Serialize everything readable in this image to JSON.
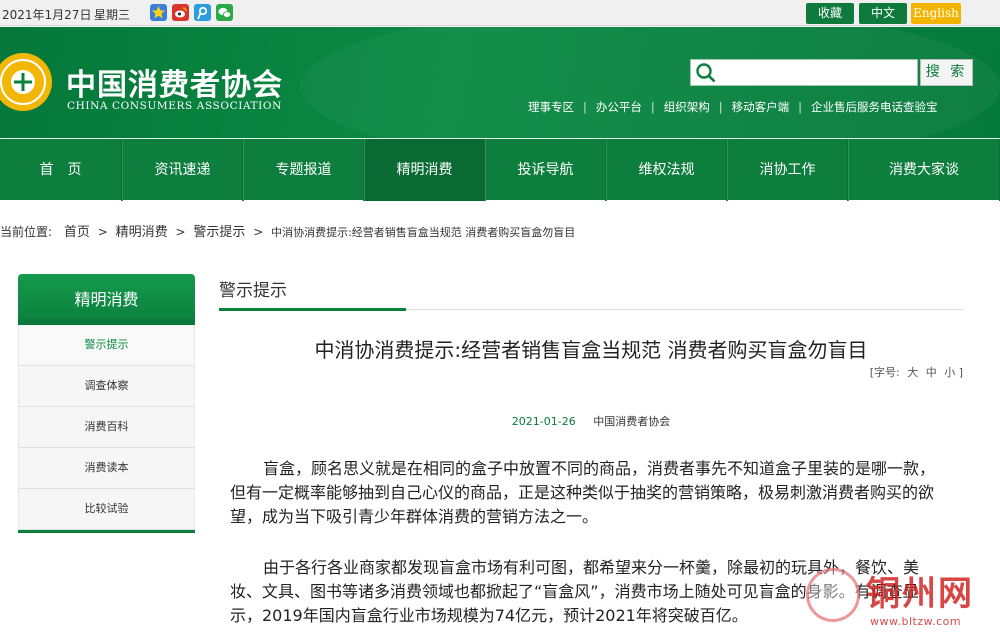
{
  "topbar": {
    "date": "2021年1月27日",
    "weekday": "星期三",
    "social_icons": [
      "qzone-icon",
      "weibo-icon",
      "tencent-weibo-icon",
      "wechat-icon"
    ],
    "lang": {
      "sc": "收藏",
      "zh": "中文",
      "en": "English"
    }
  },
  "header": {
    "org_cn": "中国消费者协会",
    "org_en": "CHINA CONSUMERS ASSOCIATION",
    "search": {
      "placeholder": "",
      "button": "搜 索"
    },
    "quicklinks": [
      "理事专区",
      "办公平台",
      "组织架构",
      "移动客户端",
      "企业售后服务电话查验宝"
    ]
  },
  "nav": {
    "items": [
      "首　页",
      "资讯速递",
      "专题报道",
      "精明消费",
      "投诉导航",
      "维权法规",
      "消协工作",
      "消费大家谈"
    ],
    "active_index": 3
  },
  "breadcrumb": {
    "prefix": "当前位置:",
    "links": [
      "首页",
      "精明消费",
      "警示提示"
    ],
    "current": "中消协消费提示:经营者销售盲盒当规范 消费者购买盲盒勿盲目"
  },
  "sidebar": {
    "title": "精明消费",
    "items": [
      "警示提示",
      "调查体察",
      "消费百科",
      "消费读本",
      "比较试验"
    ],
    "active_index": 0
  },
  "main": {
    "section_title": "警示提示",
    "article": {
      "title": "中消协消费提示:经营者销售盲盒当规范 消费者购买盲盒勿盲目",
      "fontsize_label": "[字号:",
      "fontsize_options": [
        "大",
        "中",
        "小"
      ],
      "fontsize_close": "]",
      "date": "2021-01-26",
      "source": "中国消费者协会",
      "paragraphs": [
        "盲盒，顾名思义就是在相同的盒子中放置不同的商品，消费者事先不知道盒子里装的是哪一款，但有一定概率能够抽到自己心仪的商品，正是这种类似于抽奖的营销策略，极易刺激消费者购买的欲望，成为当下吸引青少年群体消费的营销方法之一。",
        "由于各行各业商家都发现盲盒市场有利可图，都希望来分一杯羹，除最初的玩具外，餐饮、美妆、文具、图书等诸多消费领域也都掀起了“盲盒风”，消费市场上随处可见盲盒的身影。有调查显示，2019年国内盲盒行业市场规模为74亿元，预计2021年将突破百亿。"
      ]
    }
  },
  "watermark": {
    "text": "铜州网",
    "url": "www.bltzw.com"
  },
  "colors": {
    "brand_green": "#0b7f3d",
    "accent_yellow": "#f3b400",
    "watermark_red": "#cf1c1c"
  }
}
